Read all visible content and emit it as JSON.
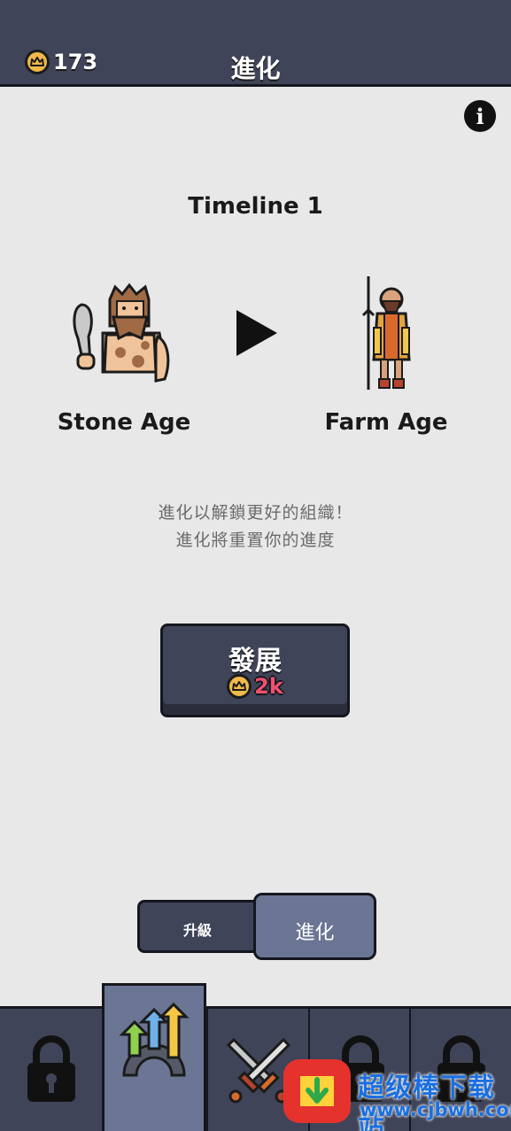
{
  "header": {
    "coins": "173",
    "title": "進化"
  },
  "info": {
    "label": "i"
  },
  "timeline": {
    "title": "Timeline 1"
  },
  "ages": {
    "from": "Stone Age",
    "to": "Farm Age"
  },
  "description": {
    "line1": "進化以解鎖更好的組織！",
    "line2": "進化將重置你的進度"
  },
  "develop": {
    "label": "發展",
    "cost": "2k"
  },
  "toggle": {
    "upgrade": "升級",
    "evolve": "進化",
    "selected": "進化"
  },
  "bottom_nav": {
    "items": [
      {
        "icon": "lock-icon",
        "locked": true
      },
      {
        "icon": "evolution-arrows-icon",
        "locked": false,
        "active": true
      },
      {
        "icon": "crossed-swords-icon",
        "locked": false
      },
      {
        "icon": "lock-icon",
        "locked": true
      },
      {
        "icon": "lock-icon",
        "locked": true
      }
    ]
  },
  "watermark": {
    "title": "超级棒下载站",
    "url": "www.cjbwh.com"
  },
  "colors": {
    "header_bg": "#3f4458",
    "page_bg": "#e8e8e8",
    "active_tab": "#6b7594",
    "coin": "#f0b94a",
    "cost": "#f0506e"
  }
}
